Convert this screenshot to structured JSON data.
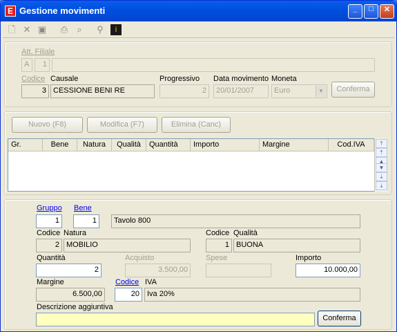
{
  "window": {
    "title": "Gestione movimenti",
    "app_icon": "E"
  },
  "toolbar": {
    "icons": [
      "new-icon",
      "delete-icon",
      "save-icon",
      "print-icon",
      "preview-icon",
      "key-icon",
      "info-icon"
    ]
  },
  "header": {
    "att_filiale_label": "Att. Filiale",
    "att_value": "A",
    "filiale_value": "1",
    "filiale_desc": "",
    "codice_label": "Codice",
    "codice_value": "3",
    "causale_label": "Causale",
    "causale_value": "CESSIONE BENI RE",
    "progressivo_label": "Progressivo",
    "progressivo_value": "2",
    "data_label": "Data movimento",
    "data_value": "20/01/2007",
    "moneta_label": "Moneta",
    "moneta_value": "Euro",
    "conferma_label": "Conferma"
  },
  "actions": {
    "nuovo": "Nuovo (F8)",
    "modifica": "Modifica (F7)",
    "elimina": "Elimina (Canc)"
  },
  "grid": {
    "columns": [
      "Gr.",
      "Bene",
      "Natura",
      "Qualità",
      "Quantità",
      "Importo",
      "Margine",
      "Cod.IVA"
    ],
    "rows": []
  },
  "detail": {
    "gruppo_label": "Gruppo",
    "gruppo_value": "1",
    "bene_label": "Bene",
    "bene_value": "1",
    "bene_desc": "Tavolo 800",
    "natura_codice_label": "Codice",
    "natura_label": "Natura",
    "natura_codice": "2",
    "natura_desc": "MOBILIO",
    "qualita_codice_label": "Codice",
    "qualita_label": "Qualità",
    "qualita_codice": "1",
    "qualita_desc": "BUONA",
    "quantita_label": "Quantità",
    "quantita_value": "2",
    "acquisto_label": "Acquisto",
    "acquisto_value": "3.500,00",
    "spese_label": "Spese",
    "spese_value": "",
    "importo_label": "Importo",
    "importo_value": "10.000,00",
    "margine_label": "Margine",
    "margine_value": "6.500,00",
    "iva_codice_label": "Codice",
    "iva_label": "IVA",
    "iva_codice": "20",
    "iva_desc": "Iva 20%",
    "descrizione_label": "Descrizione aggiuntiva",
    "descrizione_value": "",
    "conferma_label": "Conferma"
  }
}
